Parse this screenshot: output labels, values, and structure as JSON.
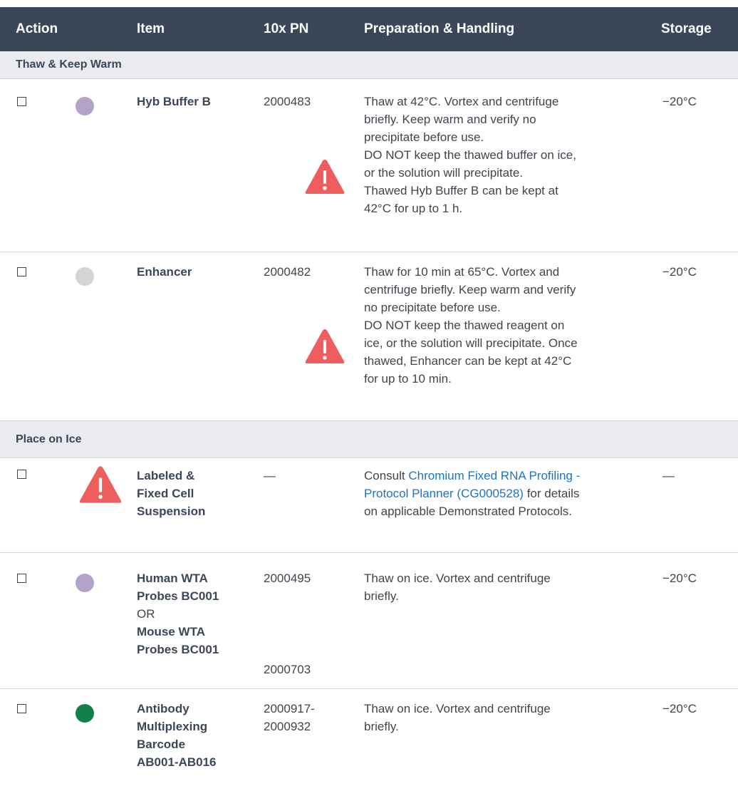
{
  "header": {
    "action": "Action",
    "item": "Item",
    "pn": "10x PN",
    "prep": "Preparation & Handling",
    "storage": "Storage"
  },
  "sections": [
    {
      "title": "Thaw & Keep Warm"
    },
    {
      "title": "Place on Ice"
    }
  ],
  "rows": [
    {
      "icon": "purple-dot",
      "icon_color": "#b4a3c9",
      "item": "Hyb Buffer B",
      "pn": "2000483",
      "prep_lines": [
        "Thaw at 42°C. Vortex and centrifuge",
        "briefly. Keep warm and verify no",
        "precipitate before use.",
        "DO NOT keep the thawed buffer on ice,",
        "or the solution will precipitate.",
        "Thawed Hyb Buffer B can be kept at",
        "42°C for up to 1 h."
      ],
      "storage": "−20°C"
    },
    {
      "icon": "gray-dot",
      "icon_color": "#d4d4d6",
      "item": "Enhancer",
      "pn": "2000482",
      "prep_lines": [
        "Thaw for 10 min at 65°C. Vortex and",
        "centrifuge briefly. Keep warm and verify",
        "no precipitate before use.",
        "DO NOT keep the thawed reagent on",
        "ice, or the solution will precipitate. Once",
        "thawed, Enhancer can be kept at 42°C",
        "for up to 10 min."
      ],
      "storage": "−20°C"
    },
    {
      "icon": "warning-icon",
      "item_lines": [
        "Labeled &",
        "Fixed Cell",
        "Suspension"
      ],
      "pn": "—",
      "prep_pre": "Consult ",
      "prep_link_1": "Chromium Fixed RNA Profiling -",
      "prep_link_2": "Protocol Planner (CG000528)",
      "prep_post_1": " for details",
      "prep_post_2": "on applicable Demonstrated Protocols.",
      "storage": "—"
    },
    {
      "icon": "purple-dot",
      "icon_color": "#b4a3c9",
      "item_lines_a": [
        "Human WTA",
        "Probes BC001"
      ],
      "or": "OR",
      "item_lines_b": [
        "Mouse WTA",
        "Probes BC001"
      ],
      "pn": "2000495",
      "pn_2": "2000703",
      "prep_lines": [
        "Thaw on ice. Vortex and centrifuge",
        "briefly."
      ],
      "storage": "−20°C"
    },
    {
      "icon": "green-dot",
      "icon_color": "#12804c",
      "item_lines": [
        "Antibody",
        "Multiplexing",
        "Barcode",
        "AB001-AB016"
      ],
      "pn_lines": [
        "2000917-",
        "2000932"
      ],
      "prep_lines": [
        "Thaw on ice. Vortex and centrifuge",
        "briefly."
      ],
      "storage": "−20°C"
    }
  ],
  "colors": {
    "header_bg": "#3b4759",
    "section_bg": "#e9ebee",
    "warning": "#ef5e5e",
    "link": "#1a73c9"
  }
}
